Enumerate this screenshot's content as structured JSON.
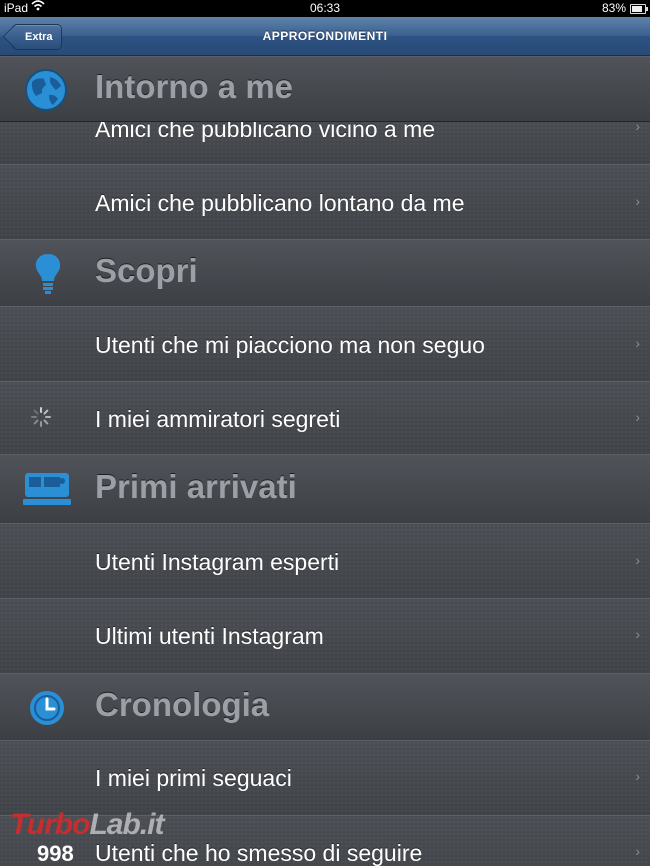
{
  "status_bar": {
    "carrier": "iPad",
    "time": "06:33",
    "battery_percent": "83%",
    "battery_level": 0.83
  },
  "nav": {
    "title": "APPROFONDIMENTI",
    "back_label": "Extra"
  },
  "sections": [
    {
      "title": "Intorno a me",
      "icon": "globe-icon",
      "rows": [
        {
          "label": "Amici che pubblicano vicino a me"
        },
        {
          "label": "Amici che pubblicano lontano da me"
        }
      ]
    },
    {
      "title": "Scopri",
      "icon": "lightbulb-icon",
      "rows": [
        {
          "label": "Utenti che mi piacciono ma non seguo"
        },
        {
          "label": "I miei ammiratori segreti",
          "icon": "loading-spinner-icon"
        }
      ]
    },
    {
      "title": "Primi arrivati",
      "icon": "camera-icon",
      "rows": [
        {
          "label": "Utenti Instagram esperti"
        },
        {
          "label": "Ultimi utenti Instagram"
        }
      ]
    },
    {
      "title": "Cronologia",
      "icon": "clock-icon",
      "rows": [
        {
          "label": "I miei primi seguaci"
        },
        {
          "label": "Utenti che ho smesso di seguire",
          "count": "998"
        }
      ]
    }
  ],
  "watermark": {
    "part1": "Turbo",
    "part2": "Lab.it"
  },
  "colors": {
    "nav_blue": "#2d5283",
    "row_text": "#ffffff",
    "header_text": "#9ba0a6",
    "icon_blue": "#2b8fd6"
  }
}
